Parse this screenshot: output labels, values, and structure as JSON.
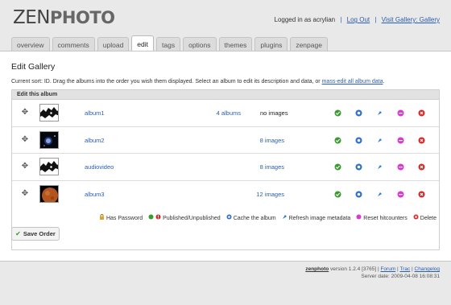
{
  "header": {
    "logo_zen": "ZEN",
    "logo_photo": "PHOTO",
    "logged_in_text": "Logged in as acrylian",
    "logout": "Log Out",
    "visit_gallery": "Visit Gallery: Gallery"
  },
  "tabs": [
    {
      "label": "overview"
    },
    {
      "label": "comments"
    },
    {
      "label": "upload"
    },
    {
      "label": "edit",
      "active": true
    },
    {
      "label": "tags"
    },
    {
      "label": "options"
    },
    {
      "label": "themes"
    },
    {
      "label": "plugins"
    },
    {
      "label": "zenpage"
    }
  ],
  "main": {
    "title": "Edit Gallery",
    "sort_note": "Current sort: ID. Drag the albums into the order you wish them displayed. Select an album to edit its description and data, or",
    "mass_edit_link": "mass-edit all album data",
    "box_header": "Edit this album",
    "albums": [
      {
        "name": "album1",
        "album_count": "4 albums",
        "images": "no images",
        "images_link": false,
        "thumb": "silhouette"
      },
      {
        "name": "album2",
        "album_count": "",
        "images": "8 images",
        "images_link": true,
        "thumb": "space"
      },
      {
        "name": "audiovideo",
        "album_count": "",
        "images": "8 images",
        "images_link": true,
        "thumb": "silhouette"
      },
      {
        "name": "album3",
        "album_count": "",
        "images": "12 images",
        "images_link": true,
        "thumb": "planet"
      }
    ]
  },
  "legend": {
    "has_password": "Has Password",
    "published": "Published/Unpublished",
    "cache": "Cache the album",
    "refresh": "Refresh image metadata",
    "reset": "Reset hitcounters",
    "delete": "Delete"
  },
  "save_button": "Save Order",
  "footer": {
    "brand": "zenphoto",
    "version": "version 1.2.4 [3765] |",
    "forum": "Forum",
    "trac": "Trac",
    "changelog": "Changelog",
    "server_date": "Server date: 2009-04-08 16:08:31"
  },
  "colors": {
    "link": "#2a5db0",
    "published": "#3a9b2d",
    "cache": "#2f6fcf",
    "refresh": "#2a7bd8",
    "reset": "#d63ad0",
    "delete": "#d62a2a"
  }
}
